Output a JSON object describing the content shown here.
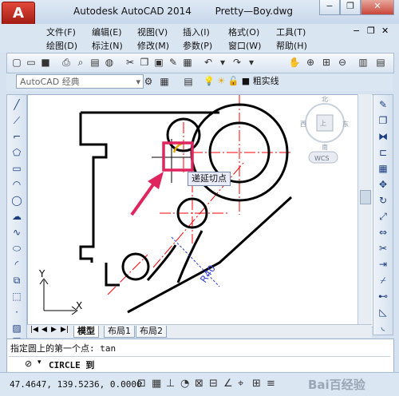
{
  "app": {
    "title": "Autodesk AutoCAD 2014",
    "document": "Pretty—Boy.dwg",
    "app_button_glyph": "A"
  },
  "window_controls": {
    "minimize": "−",
    "restore": "❐",
    "close": "✕"
  },
  "menu_row1": [
    "文件(F)",
    "编辑(E)",
    "视图(V)",
    "插入(I)",
    "格式(O)",
    "工具(T)"
  ],
  "menu_row2": [
    "绘图(D)",
    "标注(N)",
    "修改(M)",
    "参数(P)",
    "窗口(W)",
    "帮助(H)"
  ],
  "doc_controls": {
    "minimize": "−",
    "restore": "❐",
    "close": "✕"
  },
  "workspace": {
    "value": "AutoCAD 经典"
  },
  "layer": {
    "linetype": "粗实线"
  },
  "viewcube": {
    "north": "北",
    "south": "南",
    "east": "东",
    "west": "西",
    "top": "上",
    "wcs": "WCS"
  },
  "tooltip": {
    "text": "递延切点"
  },
  "dimension": {
    "text": "R40"
  },
  "ucs": {
    "x": "X",
    "y": "Y"
  },
  "layout_tabs": [
    "模型",
    "布局1",
    "布局2"
  ],
  "command": {
    "history": "指定圆上的第一个点: tan",
    "current": "CIRCLE 到"
  },
  "status": {
    "coords": "47.4647,  139.5236, 0.0000",
    "watermark": "Bai百经验"
  },
  "colors": {
    "highlight_box": "#e0245e",
    "arrow": "#e0245e",
    "center_line": "#ff0000",
    "dimension": "#2f3fd8",
    "geometry": "#000000"
  }
}
